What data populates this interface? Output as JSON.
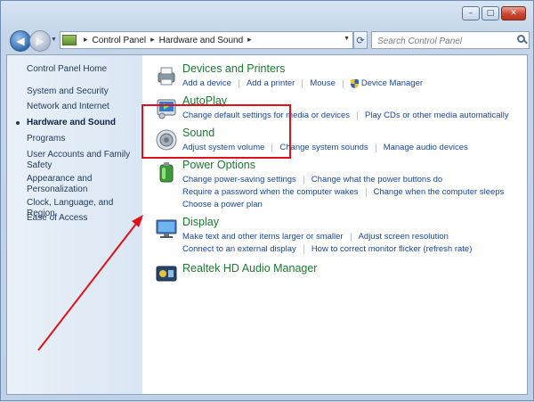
{
  "window": {
    "caption_buttons": {
      "minimize": "–",
      "maximize": "□",
      "close": "✕"
    }
  },
  "navigation": {
    "back_icon": "back-arrow-icon",
    "forward_icon": "forward-arrow-icon",
    "breadcrumb": [
      "Control Panel",
      "Hardware and Sound"
    ],
    "search_placeholder": "Search Control Panel"
  },
  "sidebar": {
    "items": [
      {
        "label": "Control Panel Home",
        "active": false
      },
      {
        "label": "System and Security",
        "active": false
      },
      {
        "label": "Network and Internet",
        "active": false
      },
      {
        "label": "Hardware and Sound",
        "active": true
      },
      {
        "label": "Programs",
        "active": false
      },
      {
        "label": "User Accounts and Family Safety",
        "active": false
      },
      {
        "label": "Appearance and Personalization",
        "active": false
      },
      {
        "label": "Clock, Language, and Region",
        "active": false
      },
      {
        "label": "Ease of Access",
        "active": false
      }
    ]
  },
  "categories": [
    {
      "title": "Devices and Printers",
      "icon": "printer-icon",
      "rows": [
        [
          "Add a device",
          "Add a printer",
          "Mouse",
          "Device Manager"
        ]
      ]
    },
    {
      "title": "AutoPlay",
      "icon": "autoplay-icon",
      "rows": [
        [
          "Change default settings for media or devices",
          "Play CDs or other media automatically"
        ]
      ]
    },
    {
      "title": "Sound",
      "icon": "speaker-icon",
      "rows": [
        [
          "Adjust system volume",
          "Change system sounds",
          "Manage audio devices"
        ]
      ]
    },
    {
      "title": "Power Options",
      "icon": "battery-icon",
      "rows": [
        [
          "Change power-saving settings",
          "Change what the power buttons do"
        ],
        [
          "Require a password when the computer wakes",
          "Change when the computer sleeps"
        ],
        [
          "Choose a power plan"
        ]
      ]
    },
    {
      "title": "Display",
      "icon": "monitor-icon",
      "rows": [
        [
          "Make text and other items larger or smaller",
          "Adjust screen resolution"
        ],
        [
          "Connect to an external display",
          "How to correct monitor flicker (refresh rate)"
        ]
      ]
    },
    {
      "title": "Realtek HD Audio Manager",
      "icon": "realtek-audio-icon",
      "rows": []
    }
  ],
  "annotation": {
    "highlight_color": "#e0111a",
    "arrow_color": "#e0111a",
    "target": "Power Options"
  },
  "colors": {
    "category_title": "#1a7a2f",
    "link": "#1848a0",
    "sidebar_text": "#1e395b"
  }
}
